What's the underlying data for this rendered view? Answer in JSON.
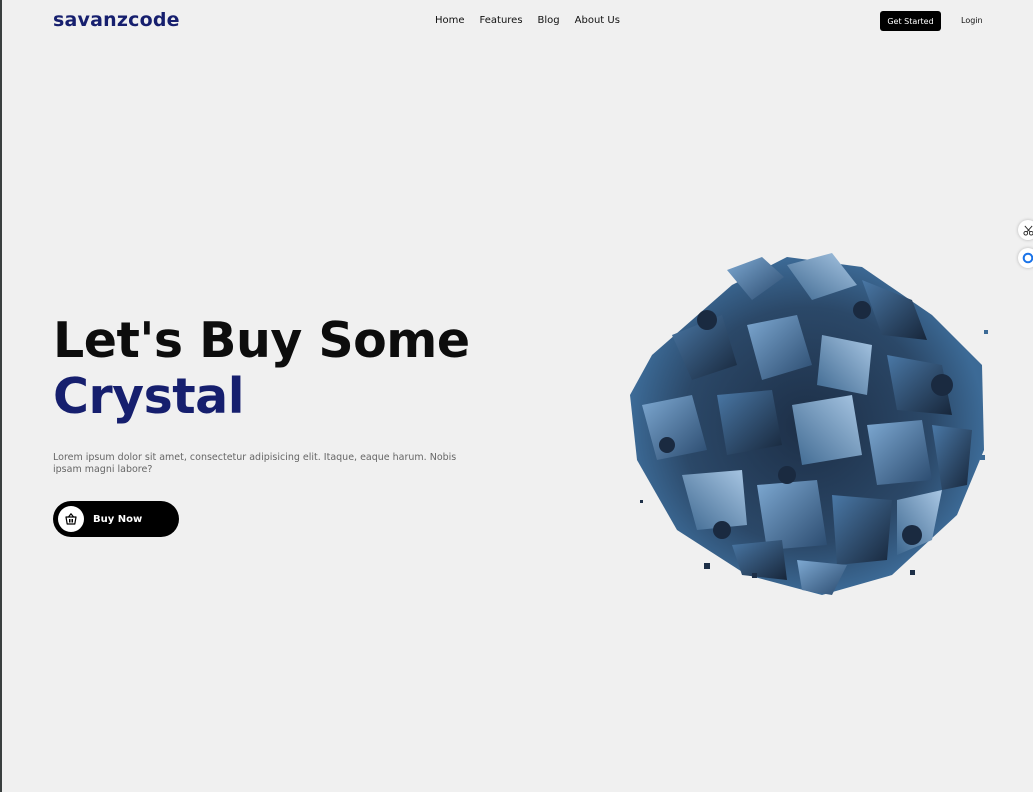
{
  "brand": {
    "logo_text": "savanzcode"
  },
  "nav": {
    "items": [
      {
        "label": "Home"
      },
      {
        "label": "Features"
      },
      {
        "label": "Blog"
      },
      {
        "label": "About Us"
      }
    ],
    "get_started_label": "Get Started",
    "login_label": "Login"
  },
  "hero": {
    "title_line1": "Let's Buy Some",
    "title_line2": "Crystal",
    "description": "Lorem ipsum dolor sit amet, consectetur adipisicing elit. Itaque, eaque harum. Nobis ipsam magni labore?",
    "button_label": "Buy Now",
    "button_icon": "basket-icon",
    "image": "crystal-cluster-image"
  },
  "side_tools": [
    {
      "icon": "scissors-icon"
    },
    {
      "icon": "circle-app-icon"
    }
  ],
  "colors": {
    "background": "#f0f0f0",
    "brand_navy": "#161f6e",
    "text_dark": "#0d0d0d",
    "button_black": "#000000",
    "crystal_blue": "#2d4a6d"
  }
}
